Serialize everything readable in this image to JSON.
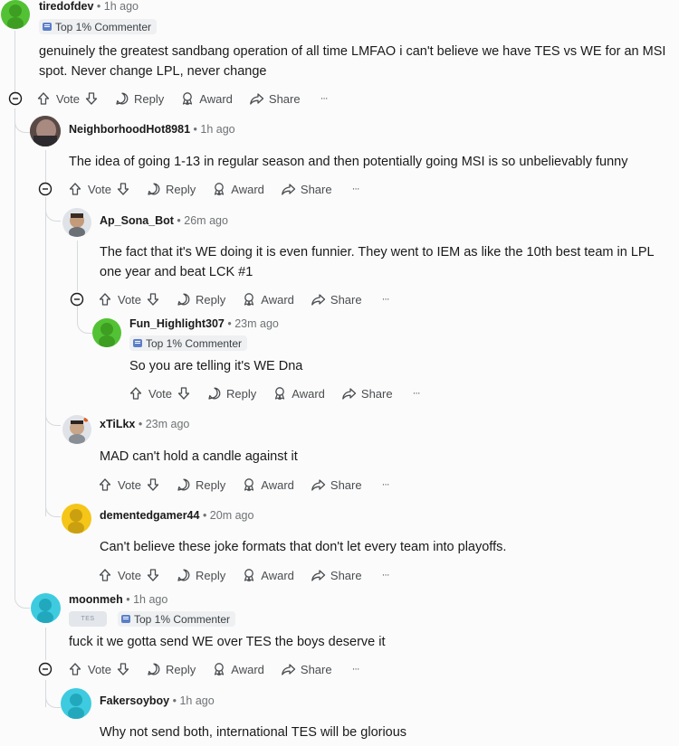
{
  "actions": {
    "vote": "Vote",
    "reply": "Reply",
    "award": "Award",
    "share": "Share",
    "more": "···"
  },
  "colors": {
    "thread_line": "#d7d9dc",
    "badge_bg": "#eef0f2",
    "avatar_green": "#52c234",
    "avatar_yellow": "#f5c518",
    "avatar_cyan": "#3ecbe0"
  },
  "comments": [
    {
      "username": "tiredofdev",
      "time": "1h ago",
      "badge": "Top 1% Commenter",
      "body": "genuinely the greatest sandbang operation of all time LMFAO i can't believe we have TES vs WE for an MSI spot. Never change LPL, never change",
      "avatar": "green-snoo"
    },
    {
      "username": "NeighborhoodHot8981",
      "time": "1h ago",
      "body": "The idea of going 1-13 in regular season and then potentially going MSI is so unbelievably funny",
      "avatar": "photo"
    },
    {
      "username": "Ap_Sona_Bot",
      "time": "26m ago",
      "body": "The fact that it's WE doing it is even funnier. They went to IEM as like the 10th best team in LPL one year and beat LCK #1",
      "avatar": "custom-snoo"
    },
    {
      "username": "Fun_Highlight307",
      "time": "23m ago",
      "badge": "Top 1% Commenter",
      "body": "So you are telling it's WE Dna",
      "avatar": "green-snoo"
    },
    {
      "username": "xTiLkx",
      "time": "23m ago",
      "body": "MAD can't hold a candle against it",
      "avatar": "custom-snoo"
    },
    {
      "username": "dementedgamer44",
      "time": "20m ago",
      "body": "Can't believe these joke formats that don't let every team into playoffs.",
      "avatar": "yellow-snoo"
    },
    {
      "username": "moonmeh",
      "time": "1h ago",
      "badge": "Top 1% Commenter",
      "flair": "TES",
      "body": "fuck it we gotta send WE over TES the boys deserve it",
      "avatar": "cyan-snoo"
    },
    {
      "username": "Fakersoyboy",
      "time": "1h ago",
      "body": "Why not send both, international TES will be glorious",
      "avatar": "cyan-snoo"
    }
  ]
}
